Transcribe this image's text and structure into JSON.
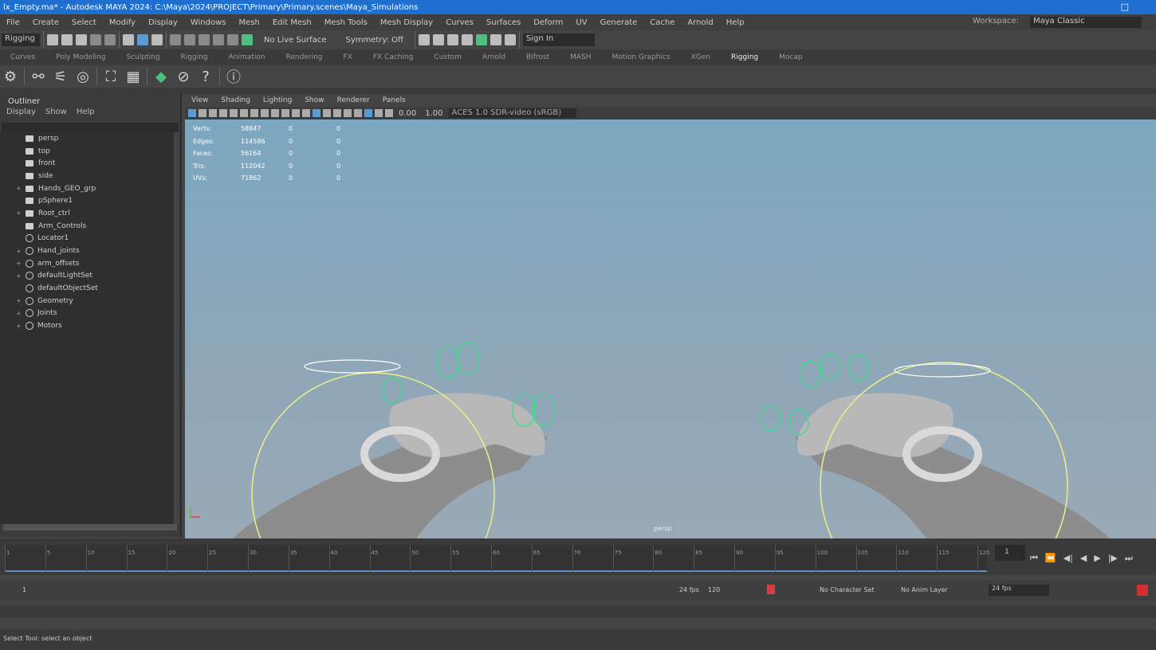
{
  "window": {
    "title": "lx_Empty.ma* - Autodesk MAYA 2024: C:\\Maya\\2024\\PROJECT\\Primary\\Primary.scenes\\Maya_Simulations",
    "close_glyph": "□"
  },
  "menubar": {
    "items": [
      "File",
      "Create",
      "Select",
      "Modify",
      "Display",
      "Windows",
      "Mesh",
      "Edit Mesh",
      "Mesh Tools",
      "Mesh Display",
      "Curves",
      "Surfaces",
      "Deform",
      "UV",
      "Generate",
      "Cache",
      "Arnold",
      "Help"
    ],
    "workspace_label": "Workspace:",
    "workspace_value": "Maya Classic"
  },
  "statusline": {
    "mode_value": "Rigging",
    "no_live_surface": "No Live Surface",
    "symmetry": "Symmetry: Off",
    "sign_in": "Sign In"
  },
  "shelftabs": {
    "items": [
      "Curves",
      "Poly Modeling",
      "Sculpting",
      "Rigging",
      "Animation",
      "Rendering",
      "FX",
      "FX Caching",
      "Custom",
      "Arnold",
      "Bifrost",
      "MASH",
      "Motion Graphics",
      "XGen",
      "Rigging",
      "Mocap"
    ],
    "active_index": 14
  },
  "outliner": {
    "title": "Outliner",
    "menu": [
      "Display",
      "Show",
      "Help"
    ],
    "items": [
      {
        "label": "persp",
        "icon": "camera-icon",
        "expand": ""
      },
      {
        "label": "top",
        "icon": "camera-icon",
        "expand": ""
      },
      {
        "label": "front",
        "icon": "camera-icon",
        "expand": ""
      },
      {
        "label": "side",
        "icon": "camera-icon",
        "expand": ""
      },
      {
        "label": "Hands_GEO_grp",
        "icon": "group-icon",
        "expand": "+"
      },
      {
        "label": "pSphere1",
        "icon": "mesh-icon",
        "expand": ""
      },
      {
        "label": "Root_ctrl",
        "icon": "curve-icon",
        "expand": "+"
      },
      {
        "label": "Arm_Controls",
        "icon": "group-icon",
        "expand": ""
      },
      {
        "label": "Locator1",
        "icon": "locator-icon",
        "expand": ""
      },
      {
        "label": "Hand_joints",
        "icon": "set-icon",
        "expand": "+"
      },
      {
        "label": "arm_offsets",
        "icon": "set-icon",
        "expand": "+"
      },
      {
        "label": "defaultLightSet",
        "icon": "set-icon",
        "expand": "+"
      },
      {
        "label": "defaultObjectSet",
        "icon": "set-icon",
        "expand": ""
      },
      {
        "label": "Geometry",
        "icon": "set-icon",
        "expand": "+"
      },
      {
        "label": "Joints",
        "icon": "set-icon",
        "expand": "+"
      },
      {
        "label": "Motors",
        "icon": "set-icon",
        "expand": "+"
      }
    ]
  },
  "viewport": {
    "menu": [
      "View",
      "Shading",
      "Lighting",
      "Show",
      "Renderer",
      "Panels"
    ],
    "field_a": "0.00",
    "field_b": "1.00",
    "colorspace": "ACES 1.0 SDR-video (sRGB)",
    "hud_rows": [
      {
        "name": "Verts:",
        "v1": "58847",
        "v2": "0",
        "v3": "0"
      },
      {
        "name": "Edges:",
        "v1": "114586",
        "v2": "0",
        "v3": "0"
      },
      {
        "name": "Faces:",
        "v1": "56164",
        "v2": "0",
        "v3": "0"
      },
      {
        "name": "Tris:",
        "v1": "112042",
        "v2": "0",
        "v3": "0"
      },
      {
        "name": "UVs:",
        "v1": "71862",
        "v2": "0",
        "v3": "0"
      }
    ],
    "camera_label": "persp"
  },
  "timeline": {
    "ticks": [
      "1",
      "5",
      "10",
      "15",
      "20",
      "25",
      "30",
      "35",
      "40",
      "45",
      "50",
      "55",
      "60",
      "65",
      "70",
      "75",
      "80",
      "85",
      "90",
      "95",
      "100",
      "105",
      "110",
      "115",
      "120"
    ],
    "current_frame": "1",
    "buttons": [
      "⏮",
      "⏪",
      "◀|",
      "◀",
      "▶",
      "|▶",
      "⏭"
    ]
  },
  "rangebar": {
    "start": "1",
    "fps": "24 fps",
    "end": "120",
    "char_set": "No Character Set",
    "anim_layer": "No Anim Layer",
    "anim_dropdown": "24 fps"
  },
  "helpline": {
    "text": "Select Tool: select an object"
  }
}
